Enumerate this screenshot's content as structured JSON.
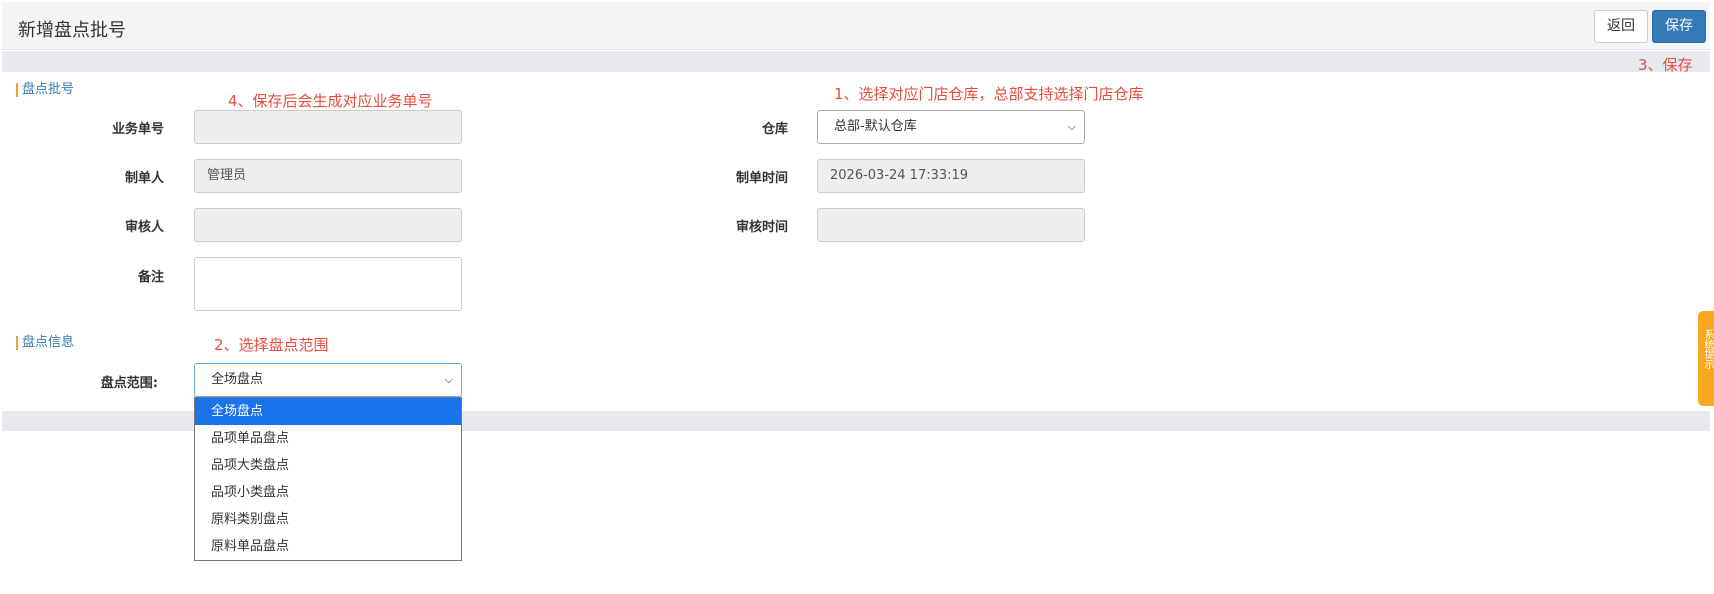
{
  "header": {
    "title": "新增盘点批号",
    "back_label": "返回",
    "save_label": "保存"
  },
  "notes": {
    "save": "3、保存",
    "warehouse": "1、选择对应门店仓库，总部支持选择门店仓库",
    "order_no": "4、保存后会生成对应业务单号",
    "scope": "2、选择盘点范围"
  },
  "section_batch": {
    "title": "盘点批号",
    "order_no_label": "业务单号",
    "order_no_value": "",
    "warehouse_label": "仓库",
    "warehouse_value": "总部-默认仓库",
    "creator_label": "制单人",
    "creator_value": "管理员",
    "create_time_label": "制单时间",
    "create_time_value": "2026-03-24 17:33:19",
    "auditor_label": "审核人",
    "auditor_value": "",
    "audit_time_label": "审核时间",
    "audit_time_value": "",
    "remark_label": "备注",
    "remark_value": ""
  },
  "section_info": {
    "title": "盘点信息",
    "scope_label": "盘点范围:",
    "scope_value": "全场盘点",
    "scope_options": [
      "全场盘点",
      "品项单品盘点",
      "品项大类盘点",
      "品项小类盘点",
      "原料类别盘点",
      "原料单品盘点"
    ]
  },
  "side_tab": {
    "label": "系统提示"
  },
  "colors": {
    "primary": "#337ab7",
    "note": "#e84c3d",
    "section_bar": "#e6a23c",
    "selected_option": "#1a73e8",
    "side_tab": "#f7a823"
  }
}
